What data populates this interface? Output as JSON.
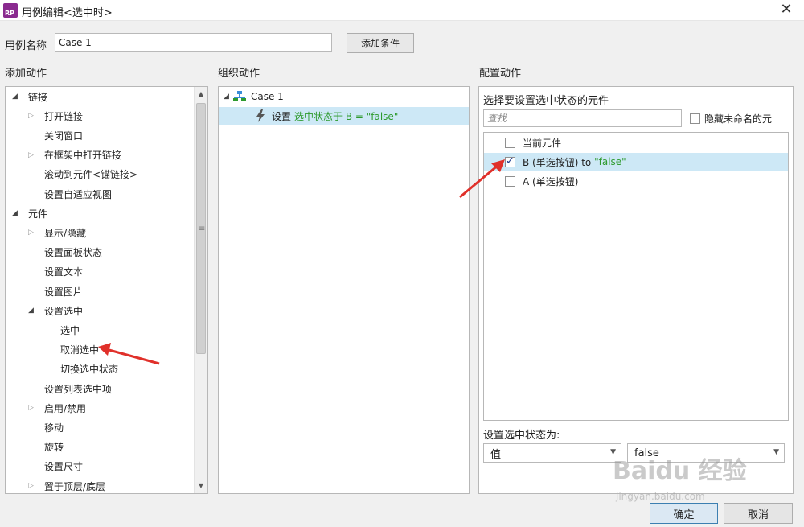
{
  "window": {
    "icon_text": "RP",
    "title": "用例编辑<选中时>",
    "close_glyph": "✕"
  },
  "case": {
    "label": "用例名称",
    "value": "Case 1",
    "add_condition": "添加条件"
  },
  "headers": {
    "add_action": "添加动作",
    "organize_action": "组织动作",
    "configure_action": "配置动作"
  },
  "action_tree": [
    {
      "label": "链接",
      "level": 0,
      "expander": "open"
    },
    {
      "label": "打开链接",
      "level": 1,
      "expander": "closed"
    },
    {
      "label": "关闭窗口",
      "level": 1,
      "expander": "none"
    },
    {
      "label": "在框架中打开链接",
      "level": 1,
      "expander": "closed"
    },
    {
      "label": "滚动到元件<锚链接>",
      "level": 1,
      "expander": "none"
    },
    {
      "label": "设置自适应视图",
      "level": 1,
      "expander": "none"
    },
    {
      "label": "元件",
      "level": 0,
      "expander": "open"
    },
    {
      "label": "显示/隐藏",
      "level": 1,
      "expander": "closed"
    },
    {
      "label": "设置面板状态",
      "level": 1,
      "expander": "none"
    },
    {
      "label": "设置文本",
      "level": 1,
      "expander": "none"
    },
    {
      "label": "设置图片",
      "level": 1,
      "expander": "none"
    },
    {
      "label": "设置选中",
      "level": 1,
      "expander": "open"
    },
    {
      "label": "选中",
      "level": 2,
      "expander": "none"
    },
    {
      "label": "取消选中",
      "level": 2,
      "expander": "none"
    },
    {
      "label": "切换选中状态",
      "level": 2,
      "expander": "none"
    },
    {
      "label": "设置列表选中项",
      "level": 1,
      "expander": "none"
    },
    {
      "label": "启用/禁用",
      "level": 1,
      "expander": "closed"
    },
    {
      "label": "移动",
      "level": 1,
      "expander": "none"
    },
    {
      "label": "旋转",
      "level": 1,
      "expander": "none"
    },
    {
      "label": "设置尺寸",
      "level": 1,
      "expander": "none"
    },
    {
      "label": "置于顶层/底层",
      "level": 1,
      "expander": "closed"
    }
  ],
  "organize": {
    "case_name": "Case 1",
    "action_prefix": "设置",
    "action_detail": "选中状态于 B = \"false\""
  },
  "configure": {
    "select_label": "选择要设置选中状态的元件",
    "search_placeholder": "查找",
    "hide_unnamed_label": "隐藏未命名的元",
    "widgets": [
      {
        "label": "当前元件",
        "detail": "",
        "checked": false,
        "selected": false
      },
      {
        "label": "B (单选按钮) to ",
        "detail": "\"false\"",
        "checked": true,
        "selected": true
      },
      {
        "label": "A (单选按钮)",
        "detail": "",
        "checked": false,
        "selected": false
      }
    ],
    "set_state_label": "设置选中状态为:",
    "value_type": "值",
    "value": "false"
  },
  "footer": {
    "ok": "确定",
    "cancel": "取消"
  },
  "watermark": {
    "text": "Baidu 经验",
    "url": "jingyan.baidu.com"
  },
  "colors": {
    "selection": "#cde8f6",
    "green_text": "#2e9a2e",
    "annotation_arrow": "#e0302a",
    "app_icon": "#8a2a8f"
  }
}
